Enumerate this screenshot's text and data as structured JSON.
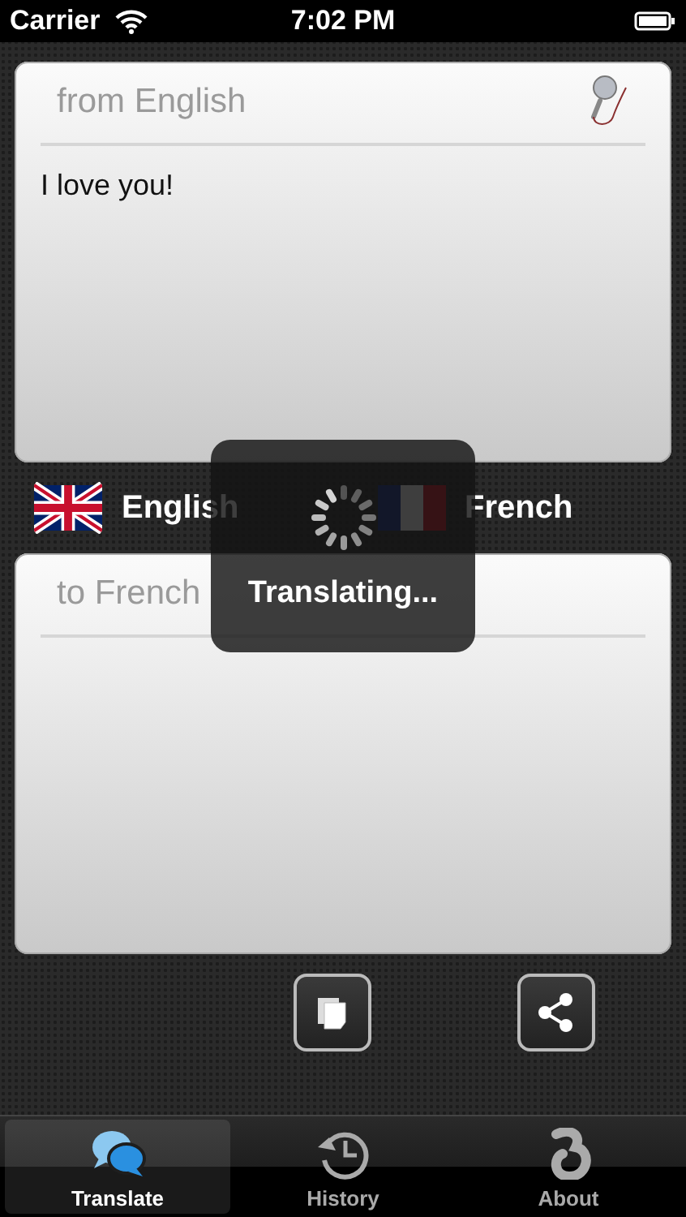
{
  "status_bar": {
    "carrier": "Carrier",
    "time": "7:02 PM"
  },
  "source": {
    "placeholder": "from English",
    "value": "I love you!"
  },
  "languages": {
    "from": "English",
    "to": "French"
  },
  "target": {
    "placeholder": "to French"
  },
  "overlay": {
    "message": "Translating..."
  },
  "tabs": [
    {
      "label": "Translate",
      "selected": true,
      "kind": "translate"
    },
    {
      "label": "History",
      "selected": false,
      "kind": "history"
    },
    {
      "label": "About",
      "selected": false,
      "kind": "about"
    }
  ]
}
